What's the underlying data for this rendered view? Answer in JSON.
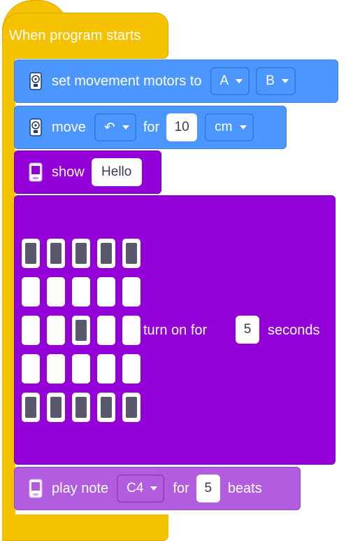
{
  "event_block": {
    "title": "When program starts",
    "color": "#f5c200"
  },
  "set_motors_block": {
    "icon": "motor-pair-icon",
    "label": "set movement motors to",
    "motor_1": "A",
    "motor_2": "B",
    "color": "#4c97ff"
  },
  "move_block": {
    "icon": "motor-pair-icon",
    "label": "move",
    "direction_icon": "↶",
    "for_label": "for",
    "distance": "10",
    "unit": "cm",
    "color": "#4c97ff"
  },
  "show_block": {
    "icon": "hub-light-matrix-icon",
    "label": "show",
    "text_value": "Hello",
    "color": "#9300d8"
  },
  "turn_on_block": {
    "matrix": [
      [
        1,
        1,
        1,
        1,
        1
      ],
      [
        0,
        0,
        0,
        0,
        0
      ],
      [
        0,
        0,
        1,
        0,
        0
      ],
      [
        0,
        0,
        0,
        0,
        0
      ],
      [
        1,
        1,
        1,
        1,
        1
      ]
    ],
    "label_before": "turn on for",
    "seconds": "5",
    "label_after": "seconds",
    "color": "#9300d8"
  },
  "play_note_block": {
    "icon": "hub-sound-icon",
    "label": "play note",
    "note": "C4",
    "for_label": "for",
    "beats": "5",
    "beats_label": "beats",
    "color": "#b25de0"
  }
}
